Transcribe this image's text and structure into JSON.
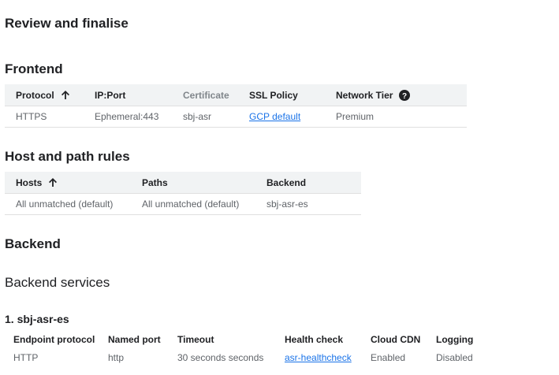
{
  "page": {
    "title": "Review and finalise"
  },
  "frontend": {
    "heading": "Frontend",
    "columns": {
      "protocol": "Protocol",
      "ip_port": "IP:Port",
      "certificate": "Certificate",
      "ssl_policy": "SSL Policy",
      "network_tier": "Network Tier"
    },
    "rows": [
      {
        "protocol": "HTTPS",
        "ip_port": "Ephemeral:443",
        "certificate": "sbj-asr",
        "ssl_policy": "GCP default",
        "network_tier": "Premium"
      }
    ]
  },
  "host_path_rules": {
    "heading": "Host and path rules",
    "columns": {
      "hosts": "Hosts",
      "paths": "Paths",
      "backend": "Backend"
    },
    "rows": [
      {
        "hosts": "All unmatched (default)",
        "paths": "All unmatched (default)",
        "backend": "sbj-asr-es"
      }
    ]
  },
  "backend": {
    "heading": "Backend",
    "services_heading": "Backend services",
    "services": [
      {
        "title": "1. sbj-asr-es",
        "labels": {
          "endpoint_protocol": "Endpoint protocol",
          "named_port": "Named port",
          "timeout": "Timeout",
          "health_check": "Health check",
          "cloud_cdn": "Cloud CDN",
          "logging": "Logging"
        },
        "values": {
          "endpoint_protocol": "HTTP",
          "named_port": "http",
          "timeout": "30 seconds seconds",
          "health_check": "asr-healthcheck",
          "cloud_cdn": "Enabled",
          "logging": "Disabled"
        }
      }
    ]
  },
  "icons": {
    "sort": "arrow-up-icon",
    "help": "help-circle-icon"
  }
}
